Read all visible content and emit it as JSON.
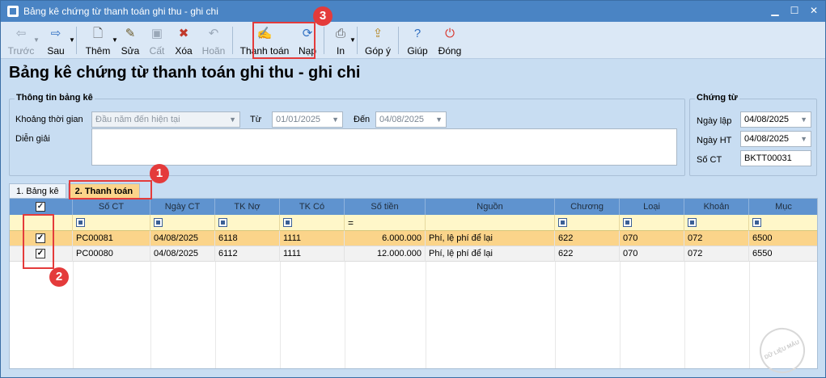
{
  "window": {
    "title": "Bảng kê chứng từ thanh toán ghi thu - ghi chi"
  },
  "toolbar": {
    "back": "Trước",
    "forward": "Sau",
    "add": "Thêm",
    "edit": "Sửa",
    "save": "Cất",
    "delete": "Xóa",
    "undo": "Hoãn",
    "pay": "Thanh toán",
    "reload": "Nạp",
    "print": "In",
    "feedback": "Góp ý",
    "help": "Giúp",
    "close": "Đóng"
  },
  "page_title": "Bảng kê chứng từ thanh toán ghi thu - ghi chi",
  "info": {
    "group_label": "Thông tin bảng kê",
    "period_label": "Khoảng thời gian",
    "period_value": "Đầu năm đến hiện tại",
    "from_label": "Từ",
    "from_value": "01/01/2025",
    "to_label": "Đến",
    "to_value": "04/08/2025",
    "desc_label": "Diễn giải",
    "desc_value": ""
  },
  "voucher": {
    "group_label": "Chứng từ",
    "date_label": "Ngày lập",
    "date_value": "04/08/2025",
    "acc_date_label": "Ngày HT",
    "acc_date_value": "04/08/2025",
    "number_label": "Số CT",
    "number_value": "BKTT00031"
  },
  "tabs": [
    {
      "label": "1. Bảng kê"
    },
    {
      "label": "2. Thanh toán"
    }
  ],
  "grid": {
    "columns": [
      "Số CT",
      "Ngày CT",
      "TK Nợ",
      "TK Có",
      "Số tiền",
      "Nguồn",
      "Chương",
      "Loại",
      "Khoản",
      "Mục"
    ],
    "filter_eq": "=",
    "rows": [
      {
        "so_ct": "PC00081",
        "ngay_ct": "04/08/2025",
        "tk_no": "6118",
        "tk_co": "1111",
        "so_tien": "6.000.000",
        "nguon": "Phí, lệ phí để lại",
        "chuong": "622",
        "loai": "070",
        "khoan": "072",
        "muc": "6500",
        "checked": true
      },
      {
        "so_ct": "PC00080",
        "ngay_ct": "04/08/2025",
        "tk_no": "6112",
        "tk_co": "1111",
        "so_tien": "12.000.000",
        "nguon": "Phí, lệ phí để lại",
        "chuong": "622",
        "loai": "070",
        "khoan": "072",
        "muc": "6550",
        "checked": true
      }
    ]
  },
  "callouts": [
    "1",
    "2",
    "3"
  ],
  "watermark": "DỮ LIỆU MẪU",
  "colors": {
    "accent": "#e43b3b",
    "selected_row": "#fbd48a",
    "header": "#5f93cf"
  }
}
